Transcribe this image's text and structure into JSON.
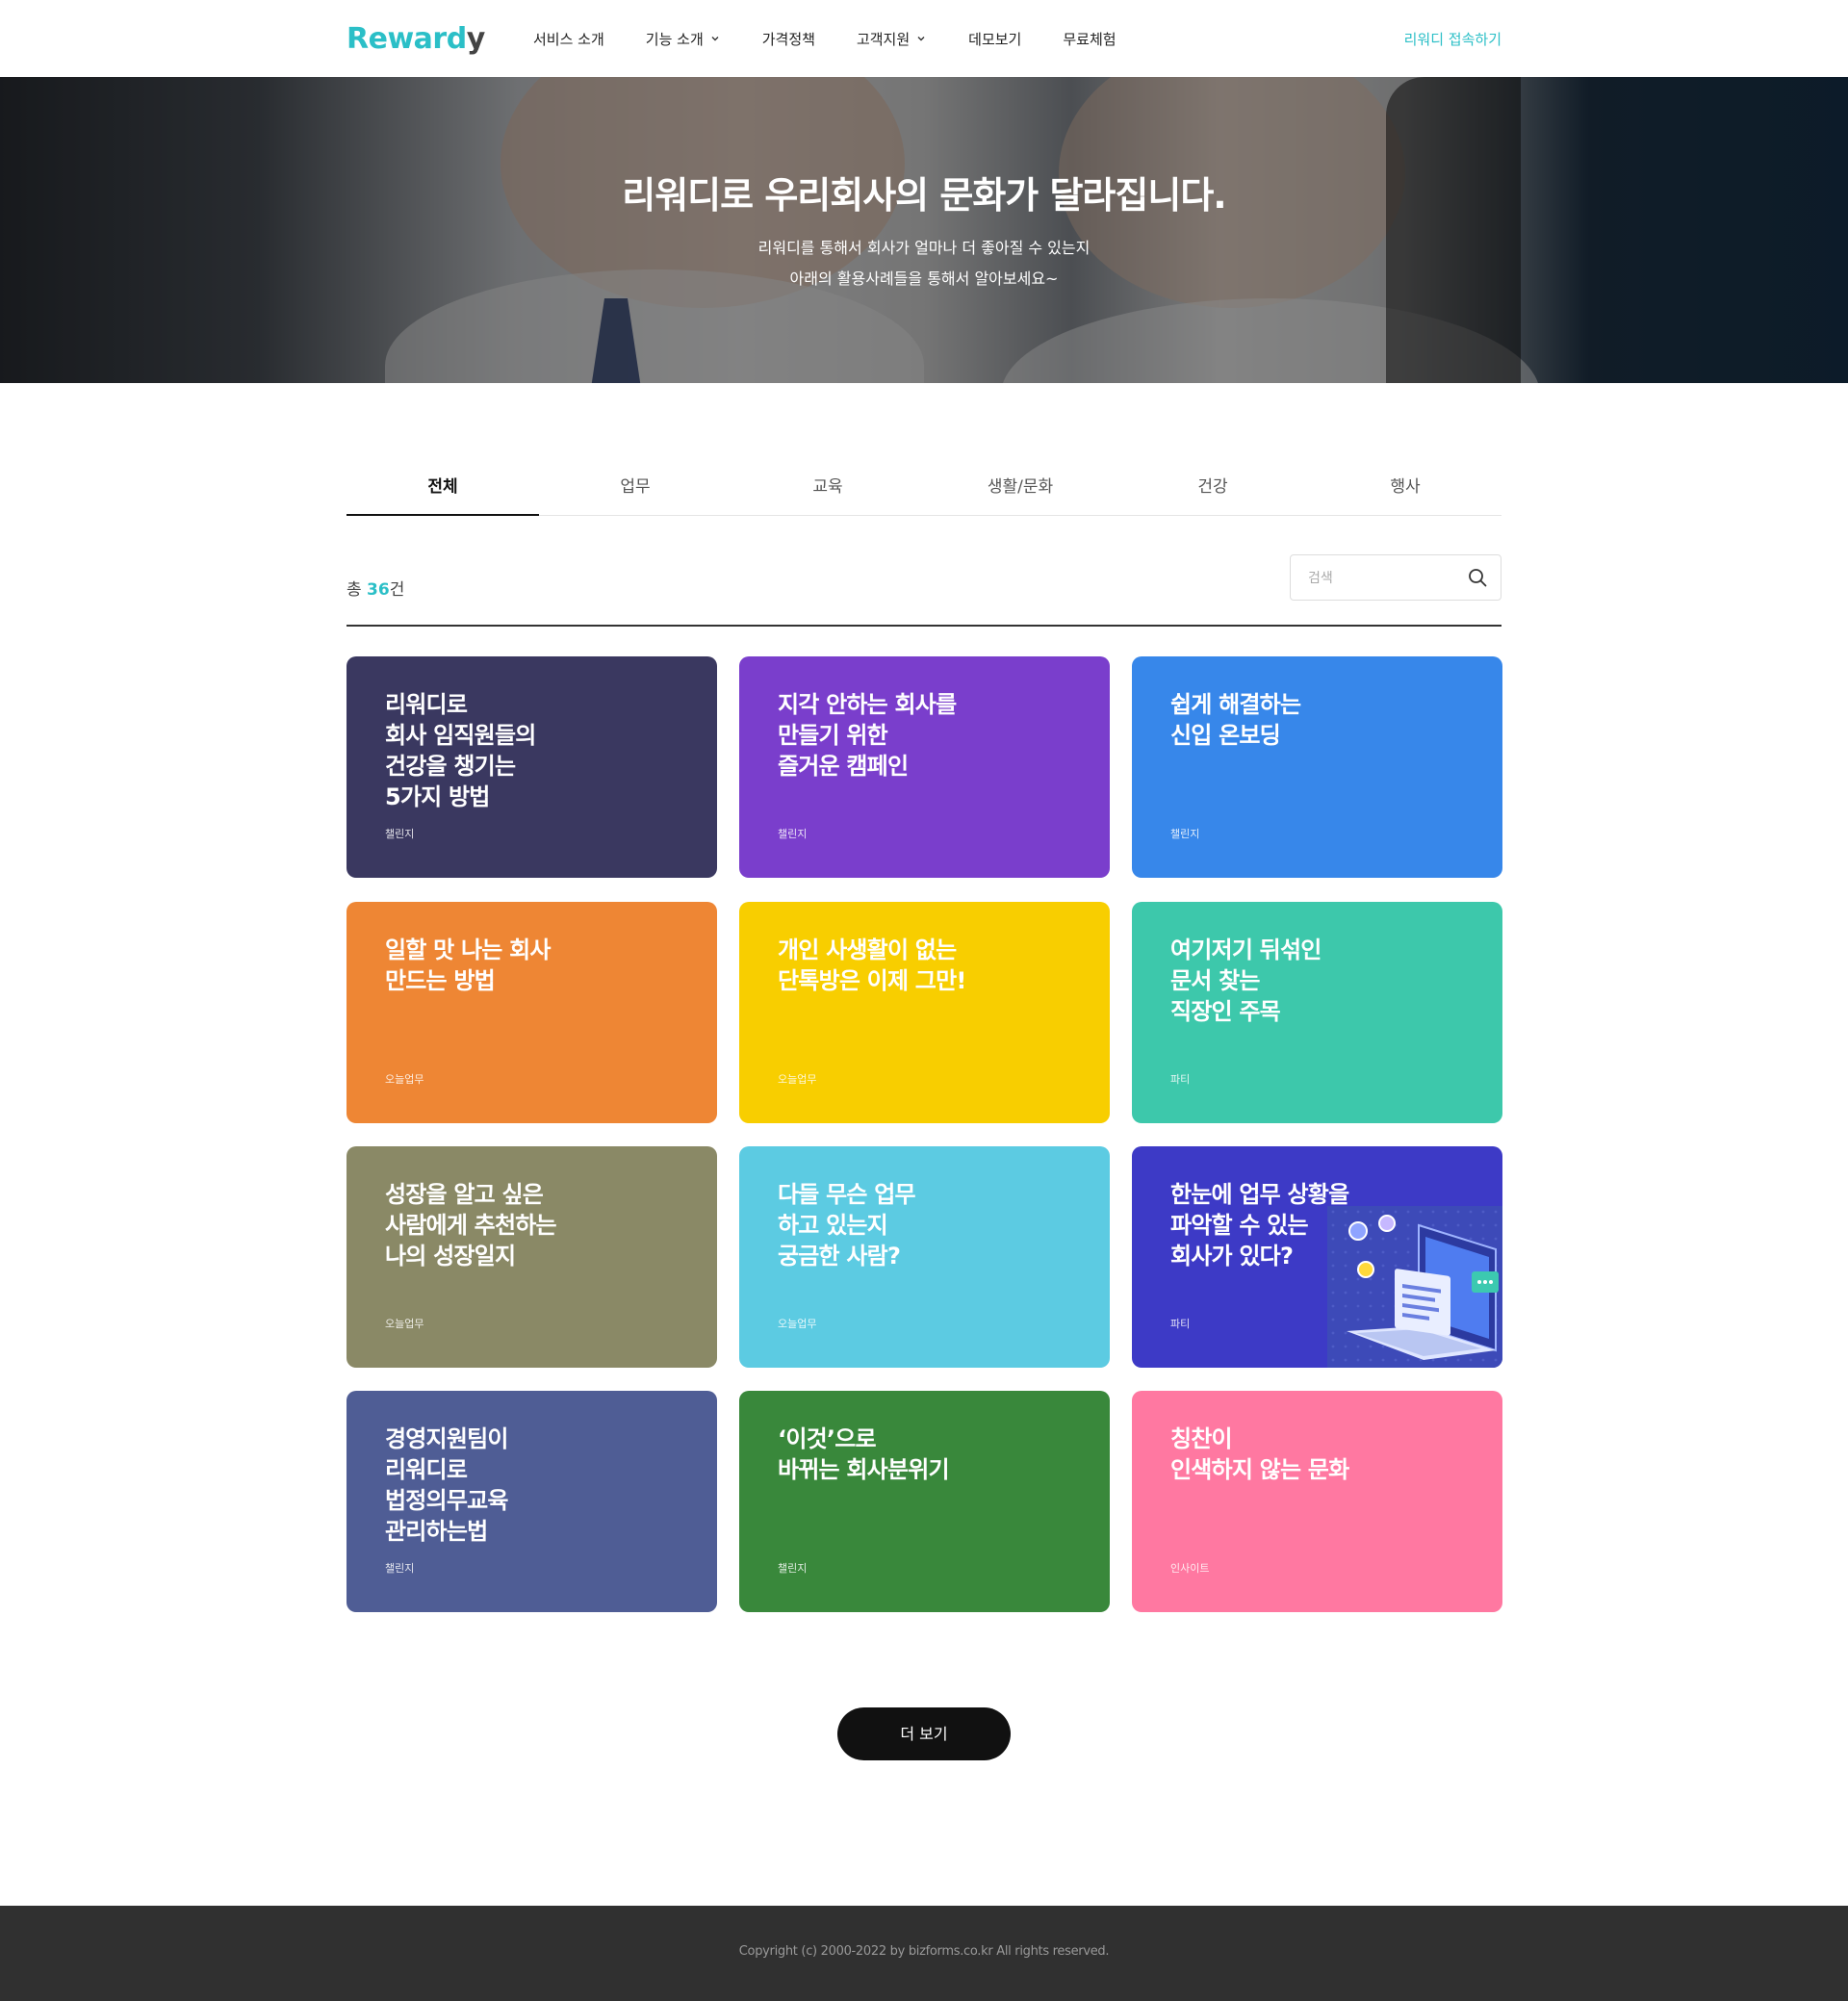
{
  "header": {
    "logo_text_a": "Reward",
    "logo_text_b": "y",
    "nav": [
      {
        "label": "서비스 소개",
        "dropdown": false
      },
      {
        "label": "기능 소개",
        "dropdown": true
      },
      {
        "label": "가격정책",
        "dropdown": false
      },
      {
        "label": "고객지원",
        "dropdown": true
      },
      {
        "label": "데모보기",
        "dropdown": false
      },
      {
        "label": "무료체험",
        "dropdown": false
      }
    ],
    "cta": "리워디 접속하기",
    "accent_color": "#2bbfc7"
  },
  "hero": {
    "title": "리워디로 우리회사의 문화가 달라집니다.",
    "subtitle_line1": "리워디를 통해서 회사가 얼마나 더 좋아질 수 있는지",
    "subtitle_line2": "아래의 활용사례들을 통해서 알아보세요~"
  },
  "tabs": [
    {
      "label": "전체",
      "active": true
    },
    {
      "label": "업무",
      "active": false
    },
    {
      "label": "교육",
      "active": false
    },
    {
      "label": "생활/문화",
      "active": false
    },
    {
      "label": "건강",
      "active": false
    },
    {
      "label": "행사",
      "active": false
    }
  ],
  "list": {
    "count_prefix": "총",
    "count": "36",
    "count_suffix": "건",
    "search_placeholder": "검색",
    "search_value": ""
  },
  "cards": [
    {
      "title": "리워디로\n회사 임직원들의\n건강을 챙기는\n5가지 방법",
      "tag": "챌린지",
      "color": "#3a3860"
    },
    {
      "title": "지각 안하는 회사를\n만들기 위한\n즐거운 캠페인",
      "tag": "챌린지",
      "color": "#7a3ecc"
    },
    {
      "title": "쉽게 해결하는\n신입 온보딩",
      "tag": "챌린지",
      "color": "#3787ea"
    },
    {
      "title": "일할 맛 나는 회사\n만드는 방법",
      "tag": "오늘업무",
      "color": "#ee8634"
    },
    {
      "title": "개인 사생활이 없는\n단톡방은 이제 그만!",
      "tag": "오늘업무",
      "color": "#f8ce00"
    },
    {
      "title": "여기저기 뒤섞인\n문서 찾는\n직장인 주목",
      "tag": "파티",
      "color": "#3dc8ab"
    },
    {
      "title": "성장을 알고 싶은\n사람에게 추천하는\n나의 성장일지",
      "tag": "오늘업무",
      "color": "#8a8966"
    },
    {
      "title": "다들 무슨 업무\n하고 있는지\n궁금한 사람?",
      "tag": "오늘업무",
      "color": "#5ccbe2"
    },
    {
      "title": "한눈에 업무 상황을\n파악할 수 있는\n회사가 있다?",
      "tag": "파티",
      "color": "#3d3ac6",
      "illustration": "laptop-illustration"
    },
    {
      "title": "경영지원팀이\n리워디로\n법정의무교육\n관리하는법",
      "tag": "챌린지",
      "color": "#4f5d95"
    },
    {
      "title": "‘이것’으로\n바뀌는 회사분위기",
      "tag": "챌린지",
      "color": "#39883b"
    },
    {
      "title": "칭찬이\n인색하지 않는 문화",
      "tag": "인사이트",
      "color": "#ff78a1"
    }
  ],
  "more_button": "더 보기",
  "footer": {
    "copyright": "Copyright (c) 2000-2022 by bizforms.co.kr All rights reserved."
  }
}
